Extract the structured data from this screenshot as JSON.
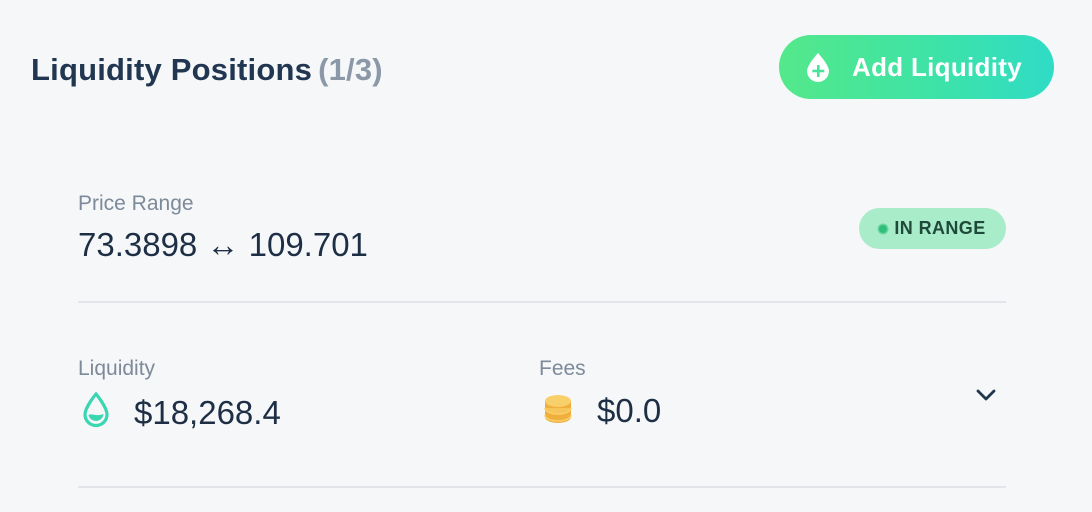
{
  "header": {
    "title": "Liquidity Positions",
    "count": "(1/3)"
  },
  "add_button": {
    "label": "Add Liquidity",
    "icon": "droplet-plus-icon"
  },
  "position": {
    "price_range": {
      "label": "Price Range",
      "value": "73.3898 ↔ 109.701"
    },
    "status": {
      "label": "IN RANGE",
      "color": "#a9ecc9"
    },
    "liquidity": {
      "label": "Liquidity",
      "value": "$18,268.4",
      "icon": "droplet-icon"
    },
    "fees": {
      "label": "Fees",
      "value": "$0.0",
      "icon": "coins-icon"
    },
    "expand_icon": "chevron-down-icon"
  },
  "colors": {
    "accent_start": "#54e88a",
    "accent_end": "#2fdcc6",
    "text_primary": "#1e2f45",
    "text_muted": "#7d8a99",
    "coin": "#f5b84a"
  }
}
